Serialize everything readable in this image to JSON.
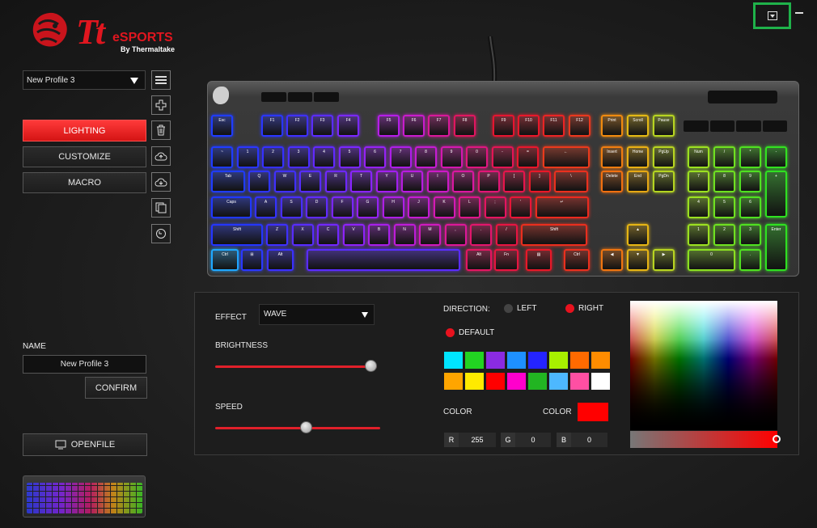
{
  "brand": {
    "tt": "Tt",
    "esports": "eSPORTS",
    "by": "By Thermaltake"
  },
  "profile": {
    "selected": "New Profile 3"
  },
  "tabs": [
    {
      "label": "LIGHTING"
    },
    {
      "label": "CUSTOMIZE"
    },
    {
      "label": "MACRO"
    }
  ],
  "name_section": {
    "label": "NAME",
    "value": "New Profile 3",
    "confirm": "CONFIRM"
  },
  "openfile": {
    "label": "OPENFILE"
  },
  "lighting": {
    "effect_label": "EFFECT",
    "effect_value": "WAVE",
    "brightness_label": "BRIGHTNESS",
    "brightness": 0.96,
    "speed_label": "SPEED",
    "speed": 0.55,
    "direction_label": "DIRECTION:",
    "direction_options": [
      "LEFT",
      "RIGHT",
      "DEFAULT"
    ],
    "direction_selected": "RIGHT",
    "color_label_1": "COLOR",
    "color_label_2": "COLOR",
    "selected_color": "#ff0000",
    "swatches": [
      "#00e5ff",
      "#22d422",
      "#8a2be2",
      "#1e90ff",
      "#2424ff",
      "#a8f000",
      "#ff6a00",
      "#ff8c00",
      "#ffa500",
      "#ffea00",
      "#ff0000",
      "#ff00cc",
      "#22b522",
      "#4db8ff",
      "#ff4fa3",
      "#ffffff"
    ],
    "rgb": {
      "r_label": "R",
      "r": "255",
      "g_label": "G",
      "g": "0",
      "b_label": "B",
      "b": "0"
    }
  },
  "keyboard": {
    "row_esc": [
      [
        "Esc",
        "#1f3cff"
      ],
      [
        "F1",
        "#2a36ff"
      ],
      [
        "F2",
        "#3e30ff"
      ],
      [
        "F3",
        "#5a2cff"
      ],
      [
        "F4",
        "#7a28ff"
      ],
      [
        "F5",
        "#b51ee8"
      ],
      [
        "F6",
        "#c81ccc"
      ],
      [
        "F7",
        "#d8189a"
      ],
      [
        "F8",
        "#e01660"
      ],
      [
        "F9",
        "#e51530"
      ],
      [
        "F10",
        "#e8182a"
      ],
      [
        "F11",
        "#ea2424"
      ],
      [
        "F12",
        "#e9381e"
      ]
    ],
    "row_num": [
      [
        "~",
        "#1f3cff"
      ],
      [
        "1",
        "#2a36ff"
      ],
      [
        "2",
        "#3530ff"
      ],
      [
        "3",
        "#4a2dff"
      ],
      [
        "4",
        "#6229ff"
      ],
      [
        "5",
        "#7a26ff"
      ],
      [
        "6",
        "#9522f5"
      ],
      [
        "7",
        "#ad1ee8"
      ],
      [
        "8",
        "#c51cd2"
      ],
      [
        "9",
        "#d418b0"
      ],
      [
        "0",
        "#df1680"
      ],
      [
        "-",
        "#e41555"
      ],
      [
        "=",
        "#e8172c"
      ],
      [
        "←",
        "#e93a1c"
      ]
    ],
    "row_tab": [
      [
        "Tab",
        "#1f3cff"
      ],
      [
        "Q",
        "#2e34ff"
      ],
      [
        "W",
        "#4030ff"
      ],
      [
        "E",
        "#562cff"
      ],
      [
        "R",
        "#6e28ff"
      ],
      [
        "T",
        "#8924ff"
      ],
      [
        "Y",
        "#a21ff0"
      ],
      [
        "U",
        "#b81ce0"
      ],
      [
        "I",
        "#cc1ac6"
      ],
      [
        "O",
        "#da18a0"
      ],
      [
        "P",
        "#e21676"
      ],
      [
        "[",
        "#e6154c"
      ],
      [
        "]",
        "#e91828"
      ],
      [
        "\\",
        "#ea301e"
      ]
    ],
    "row_caps": [
      [
        "Caps",
        "#2038ff"
      ],
      [
        "A",
        "#3432ff"
      ],
      [
        "S",
        "#482eff"
      ],
      [
        "D",
        "#602aff"
      ],
      [
        "F",
        "#7a26ff"
      ],
      [
        "G",
        "#9522f5"
      ],
      [
        "H",
        "#ae1fe6"
      ],
      [
        "J",
        "#c31cd2"
      ],
      [
        "K",
        "#d41ab4"
      ],
      [
        "L",
        "#de168a"
      ],
      [
        ";",
        "#e41560"
      ],
      [
        "'",
        "#e81638"
      ],
      [
        "↵",
        "#ea2a1f"
      ]
    ],
    "row_shift": [
      [
        "Shift",
        "#2436ff"
      ],
      [
        "Z",
        "#3e30ff"
      ],
      [
        "X",
        "#582cff"
      ],
      [
        "C",
        "#7227ff"
      ],
      [
        "V",
        "#8e23f8"
      ],
      [
        "B",
        "#a81fea"
      ],
      [
        "N",
        "#be1cd8"
      ],
      [
        "M",
        "#d01abe"
      ],
      [
        ",",
        "#dc1898"
      ],
      [
        ".",
        "#e2166c"
      ],
      [
        "/",
        "#e71542"
      ],
      [
        "Shift",
        "#ea2e1e"
      ]
    ],
    "row_ctrl": [
      [
        "Ctrl",
        "#1fa8ff"
      ],
      [
        "⊞",
        "#2a38ff"
      ],
      [
        "Alt",
        "#3a30ff"
      ],
      [
        "",
        "#5a2cff"
      ],
      [
        "Alt",
        "#e41662"
      ],
      [
        "Fn",
        "#e61540"
      ],
      [
        "▤",
        "#e81828"
      ],
      [
        "Ctrl",
        "#ea301e"
      ]
    ],
    "nav_top": [
      [
        "Print",
        "#f08a0f"
      ],
      [
        "Scroll",
        "#e3b814"
      ],
      [
        "Pause",
        "#b7d421"
      ]
    ],
    "nav_1": [
      [
        "Insert",
        "#f07d10"
      ],
      [
        "Home",
        "#e9b014"
      ],
      [
        "PgUp",
        "#b7d421"
      ]
    ],
    "nav_2": [
      [
        "Delete",
        "#f07010"
      ],
      [
        "End",
        "#e6a814"
      ],
      [
        "PgDn",
        "#b4d421"
      ]
    ],
    "arrows": [
      [
        "▲",
        "#e6b514"
      ],
      [
        "◀",
        "#f07510"
      ],
      [
        "▼",
        "#e6b514"
      ],
      [
        "▶",
        "#b8d421"
      ]
    ],
    "numpad": [
      [
        "Num",
        "#9be021"
      ],
      [
        "/",
        "#6fe021"
      ],
      [
        "*",
        "#4fe021"
      ],
      [
        "-",
        "#33e021"
      ],
      [
        "7",
        "#9be021"
      ],
      [
        "8",
        "#6fe021"
      ],
      [
        "9",
        "#4fe021"
      ],
      [
        "+",
        "#2fe021"
      ],
      [
        "4",
        "#9be021"
      ],
      [
        "5",
        "#6fe021"
      ],
      [
        "6",
        "#4fe021"
      ],
      [
        "1",
        "#9be021"
      ],
      [
        "2",
        "#6fe021"
      ],
      [
        "3",
        "#4fe021"
      ],
      [
        "Enter",
        "#2fe021"
      ],
      [
        "0",
        "#8be021"
      ],
      [
        ".",
        "#4fe021"
      ]
    ]
  }
}
